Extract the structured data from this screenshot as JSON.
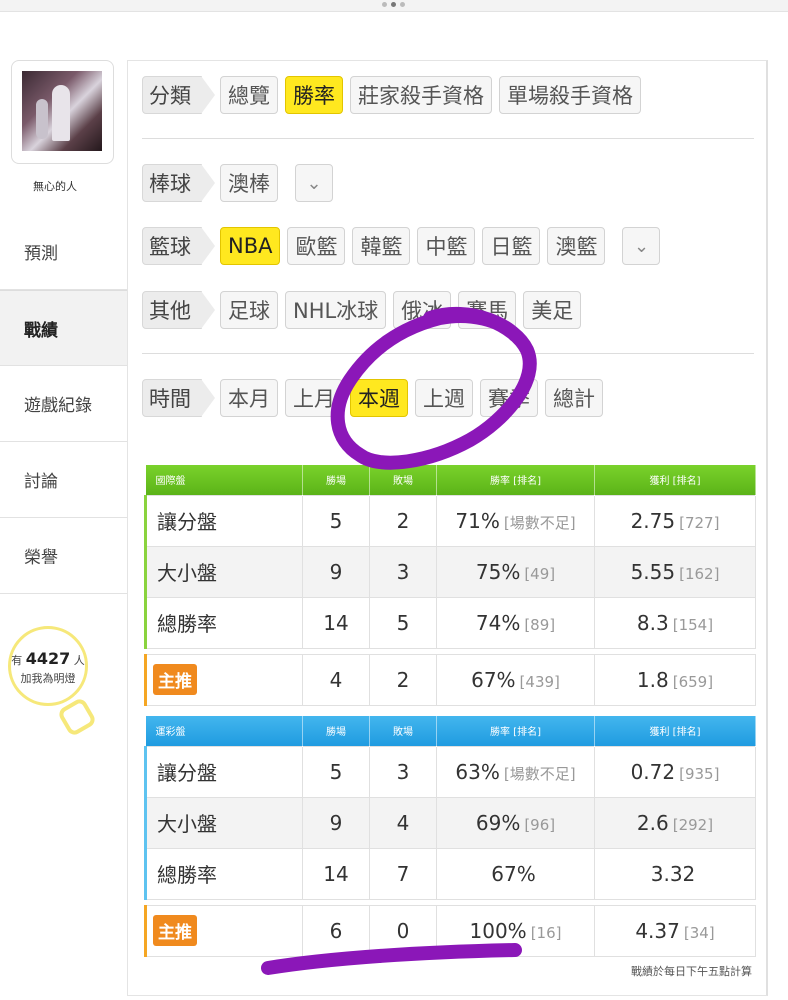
{
  "username": "無心的人",
  "sidebar": {
    "items": [
      {
        "label": "預測"
      },
      {
        "label": "戰績"
      },
      {
        "label": "遊戲紀錄"
      },
      {
        "label": "討論"
      },
      {
        "label": "榮譽"
      }
    ],
    "active_index": 1
  },
  "fans": {
    "prefix": "有",
    "count": "4427",
    "suffix": "人",
    "cta": "加我為明燈"
  },
  "filters": {
    "category": {
      "label": "分類",
      "options": [
        "總覽",
        "勝率",
        "莊家殺手資格",
        "單場殺手資格"
      ],
      "selected": "勝率"
    },
    "baseball": {
      "label": "棒球",
      "options": [
        "澳棒"
      ]
    },
    "basketball": {
      "label": "籃球",
      "options": [
        "NBA",
        "歐籃",
        "韓籃",
        "中籃",
        "日籃",
        "澳籃"
      ],
      "selected": "NBA"
    },
    "other": {
      "label": "其他",
      "options": [
        "足球",
        "NHL冰球",
        "俄冰",
        "賽馬",
        "美足"
      ]
    },
    "time": {
      "label": "時間",
      "options": [
        "本月",
        "上月",
        "本週",
        "上週",
        "賽季",
        "總計"
      ],
      "selected": "本週"
    }
  },
  "tables": {
    "international": {
      "header": [
        "國際盤",
        "勝場",
        "敗場",
        "勝率 [排名]",
        "獲利 [排名]"
      ],
      "rows": [
        {
          "name": "讓分盤",
          "win": "5",
          "lose": "2",
          "rate": "71%",
          "rate_rank": "[場數不足]",
          "profit": "2.75",
          "profit_rank": "[727]"
        },
        {
          "name": "大小盤",
          "win": "9",
          "lose": "3",
          "rate": "75%",
          "rate_rank": "[49]",
          "profit": "5.55",
          "profit_rank": "[162]"
        },
        {
          "name": "總勝率",
          "win": "14",
          "lose": "5",
          "rate": "74%",
          "rate_rank": "[89]",
          "profit": "8.3",
          "profit_rank": "[154]"
        }
      ],
      "featured": {
        "tag": "主推",
        "win": "4",
        "lose": "2",
        "rate": "67%",
        "rate_rank": "[439]",
        "profit": "1.8",
        "profit_rank": "[659]"
      }
    },
    "lottery": {
      "header": [
        "運彩盤",
        "勝場",
        "敗場",
        "勝率 [排名]",
        "獲利 [排名]"
      ],
      "rows": [
        {
          "name": "讓分盤",
          "win": "5",
          "lose": "3",
          "rate": "63%",
          "rate_rank": "[場數不足]",
          "profit": "0.72",
          "profit_rank": "[935]"
        },
        {
          "name": "大小盤",
          "win": "9",
          "lose": "4",
          "rate": "69%",
          "rate_rank": "[96]",
          "profit": "2.6",
          "profit_rank": "[292]"
        },
        {
          "name": "總勝率",
          "win": "14",
          "lose": "7",
          "rate": "67%",
          "rate_rank": "",
          "profit": "3.32",
          "profit_rank": ""
        }
      ],
      "featured": {
        "tag": "主推",
        "win": "6",
        "lose": "0",
        "rate": "100%",
        "rate_rank": "[16]",
        "profit": "4.37",
        "profit_rank": "[34]"
      }
    }
  },
  "footnote": "戰績於每日下午五點計算",
  "colors": {
    "selected_chip": "#ffe81f",
    "international_header": "#6cc623",
    "lottery_header": "#2aa6e8",
    "featured_tag": "#f08a1e",
    "annotation": "#8b17b8"
  }
}
